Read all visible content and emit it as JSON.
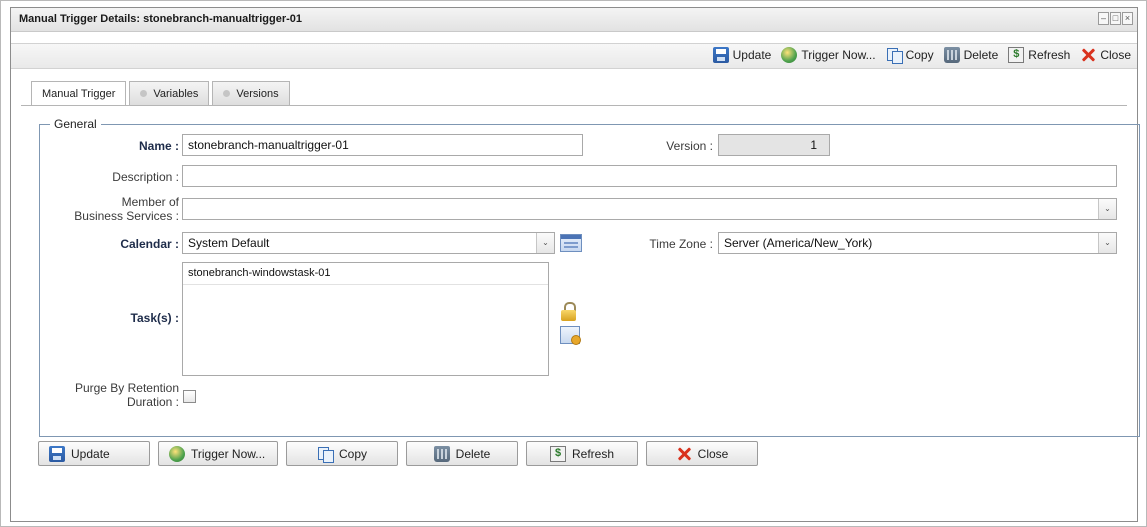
{
  "window": {
    "title": "Manual Trigger Details: stonebranch-manualtrigger-01"
  },
  "toolbar": {
    "update": "Update",
    "trigger_now": "Trigger Now...",
    "copy": "Copy",
    "delete": "Delete",
    "refresh": "Refresh",
    "close": "Close"
  },
  "tabs": [
    "Manual Trigger",
    "Variables",
    "Versions"
  ],
  "general": {
    "legend": "General",
    "name_label": "Name :",
    "name_value": "stonebranch-manualtrigger-01",
    "version_label": "Version :",
    "version_value": "1",
    "description_label": "Description :",
    "description_value": "",
    "member_label_1": "Member of",
    "member_label_2": "Business Services :",
    "member_value": "",
    "calendar_label": "Calendar :",
    "calendar_value": "System Default",
    "timezone_label": "Time Zone :",
    "timezone_value": "Server (America/New_York)",
    "tasks_label": "Task(s) :",
    "tasks": [
      "stonebranch-windowstask-01"
    ],
    "purge_label_1": "Purge By Retention",
    "purge_label_2": "Duration :",
    "purge_checked": false
  },
  "buttons": {
    "update": "Update",
    "trigger_now": "Trigger Now...",
    "copy": "Copy",
    "delete": "Delete",
    "refresh": "Refresh",
    "close": "Close"
  },
  "icons": {
    "update": "save-icon",
    "trigger_now": "trigger-icon",
    "copy": "copy-icon",
    "delete": "delete-icon",
    "refresh": "refresh-icon",
    "close": "close-icon"
  }
}
